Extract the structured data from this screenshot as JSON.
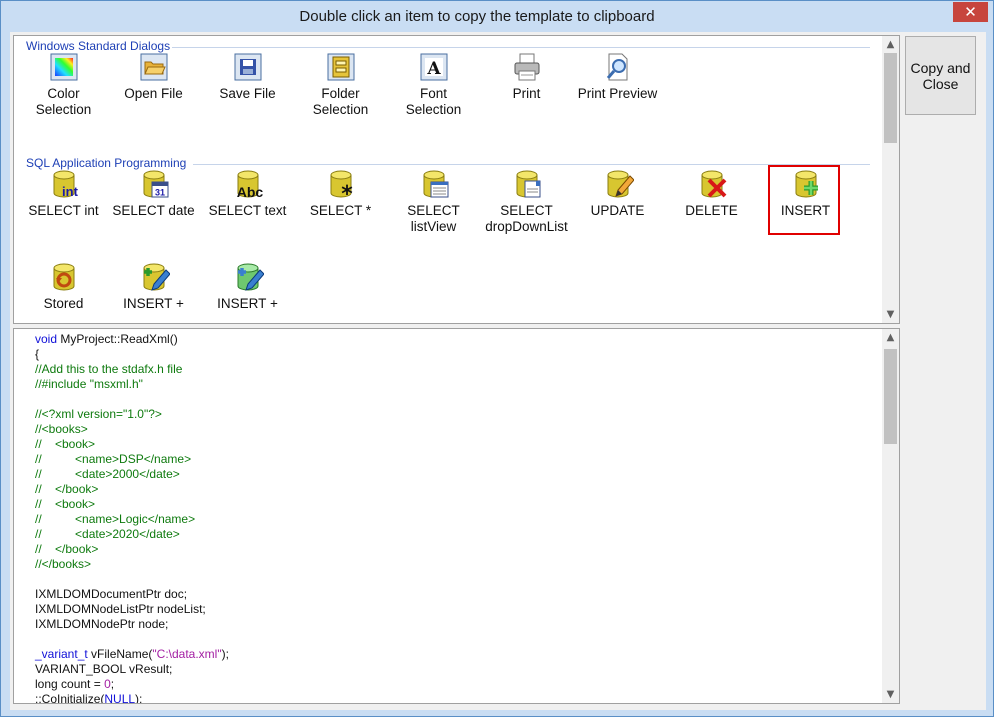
{
  "window": {
    "title": "Double click an item to copy the template to clipboard",
    "close_symbol": "✕"
  },
  "copy_button": {
    "label": "Copy and\nClose"
  },
  "groups": [
    {
      "header": "Windows Standard Dialogs",
      "items": [
        {
          "label": "Color\nSelection",
          "icon": "color-palette-icon"
        },
        {
          "label": "Open File",
          "icon": "folder-open-icon"
        },
        {
          "label": "Save File",
          "icon": "floppy-disk-icon"
        },
        {
          "label": "Folder\nSelection",
          "icon": "folder-select-icon"
        },
        {
          "label": "Font\nSelection",
          "icon": "font-icon"
        },
        {
          "label": "Print",
          "icon": "printer-icon"
        },
        {
          "label": "Print Preview",
          "icon": "print-preview-icon"
        }
      ]
    },
    {
      "header": "SQL Application Programming",
      "items": [
        {
          "label": "SELECT int",
          "icon": "db-int-icon",
          "badge": "int"
        },
        {
          "label": "SELECT date",
          "icon": "db-date-icon",
          "badge": "31"
        },
        {
          "label": "SELECT text",
          "icon": "db-text-icon",
          "badge": "Abc"
        },
        {
          "label": "SELECT *",
          "icon": "db-star-icon",
          "badge": "*"
        },
        {
          "label": "SELECT\nlistView",
          "icon": "db-listview-icon"
        },
        {
          "label": "SELECT\ndropDownList",
          "icon": "db-dropdown-icon"
        },
        {
          "label": "UPDATE",
          "icon": "db-update-icon"
        },
        {
          "label": "DELETE",
          "icon": "db-delete-icon"
        },
        {
          "label": "INSERT",
          "icon": "db-insert-icon",
          "selected": true
        },
        {
          "label": "Stored",
          "icon": "db-stored-icon"
        },
        {
          "label": "INSERT +",
          "icon": "db-insert-plus-icon"
        },
        {
          "label": "INSERT +",
          "icon": "db-insert-plus-2-icon"
        }
      ]
    }
  ],
  "code_lines": [
    [
      {
        "t": "void ",
        "c": "kw"
      },
      {
        "t": "MyProject::ReadXml()",
        "c": "tx"
      }
    ],
    [
      {
        "t": "{",
        "c": "tx"
      }
    ],
    [
      {
        "t": "//Add this to the stdafx.h file",
        "c": "cm"
      }
    ],
    [
      {
        "t": "//#include \"msxml.h\"",
        "c": "cm"
      }
    ],
    [],
    [
      {
        "t": "//<?xml version=\"1.0\"?>",
        "c": "cm"
      }
    ],
    [
      {
        "t": "//<books>",
        "c": "cm"
      }
    ],
    [
      {
        "t": "//    <book>",
        "c": "cm"
      }
    ],
    [
      {
        "t": "//          <name>DSP</name>",
        "c": "cm"
      }
    ],
    [
      {
        "t": "//          <date>2000</date>",
        "c": "cm"
      }
    ],
    [
      {
        "t": "//    </book>",
        "c": "cm"
      }
    ],
    [
      {
        "t": "//    <book>",
        "c": "cm"
      }
    ],
    [
      {
        "t": "//          <name>Logic</name>",
        "c": "cm"
      }
    ],
    [
      {
        "t": "//          <date>2020</date>",
        "c": "cm"
      }
    ],
    [
      {
        "t": "//    </book>",
        "c": "cm"
      }
    ],
    [
      {
        "t": "//</books>",
        "c": "cm"
      }
    ],
    [],
    [
      {
        "t": "IXMLDOMDocumentPtr doc;",
        "c": "tx"
      }
    ],
    [
      {
        "t": "IXMLDOMNodeListPtr nodeList;",
        "c": "tx"
      }
    ],
    [
      {
        "t": "IXMLDOMNodePtr node;",
        "c": "tx"
      }
    ],
    [],
    [
      {
        "t": "_variant_t ",
        "c": "kw"
      },
      {
        "t": "vFileName(",
        "c": "tx"
      },
      {
        "t": "\"C:\\data.xml\"",
        "c": "st"
      },
      {
        "t": ");",
        "c": "tx"
      }
    ],
    [
      {
        "t": "VARIANT_BOOL vResult;",
        "c": "tx"
      }
    ],
    [
      {
        "t": "long count = ",
        "c": "tx"
      },
      {
        "t": "0",
        "c": "st"
      },
      {
        "t": ";",
        "c": "tx"
      }
    ],
    [
      {
        "t": "::CoInitialize(",
        "c": "tx"
      },
      {
        "t": "NULL",
        "c": "kw"
      },
      {
        "t": ");",
        "c": "tx"
      }
    ]
  ],
  "scrollbar": {
    "up_symbol": "▲",
    "down_symbol": "▼"
  }
}
